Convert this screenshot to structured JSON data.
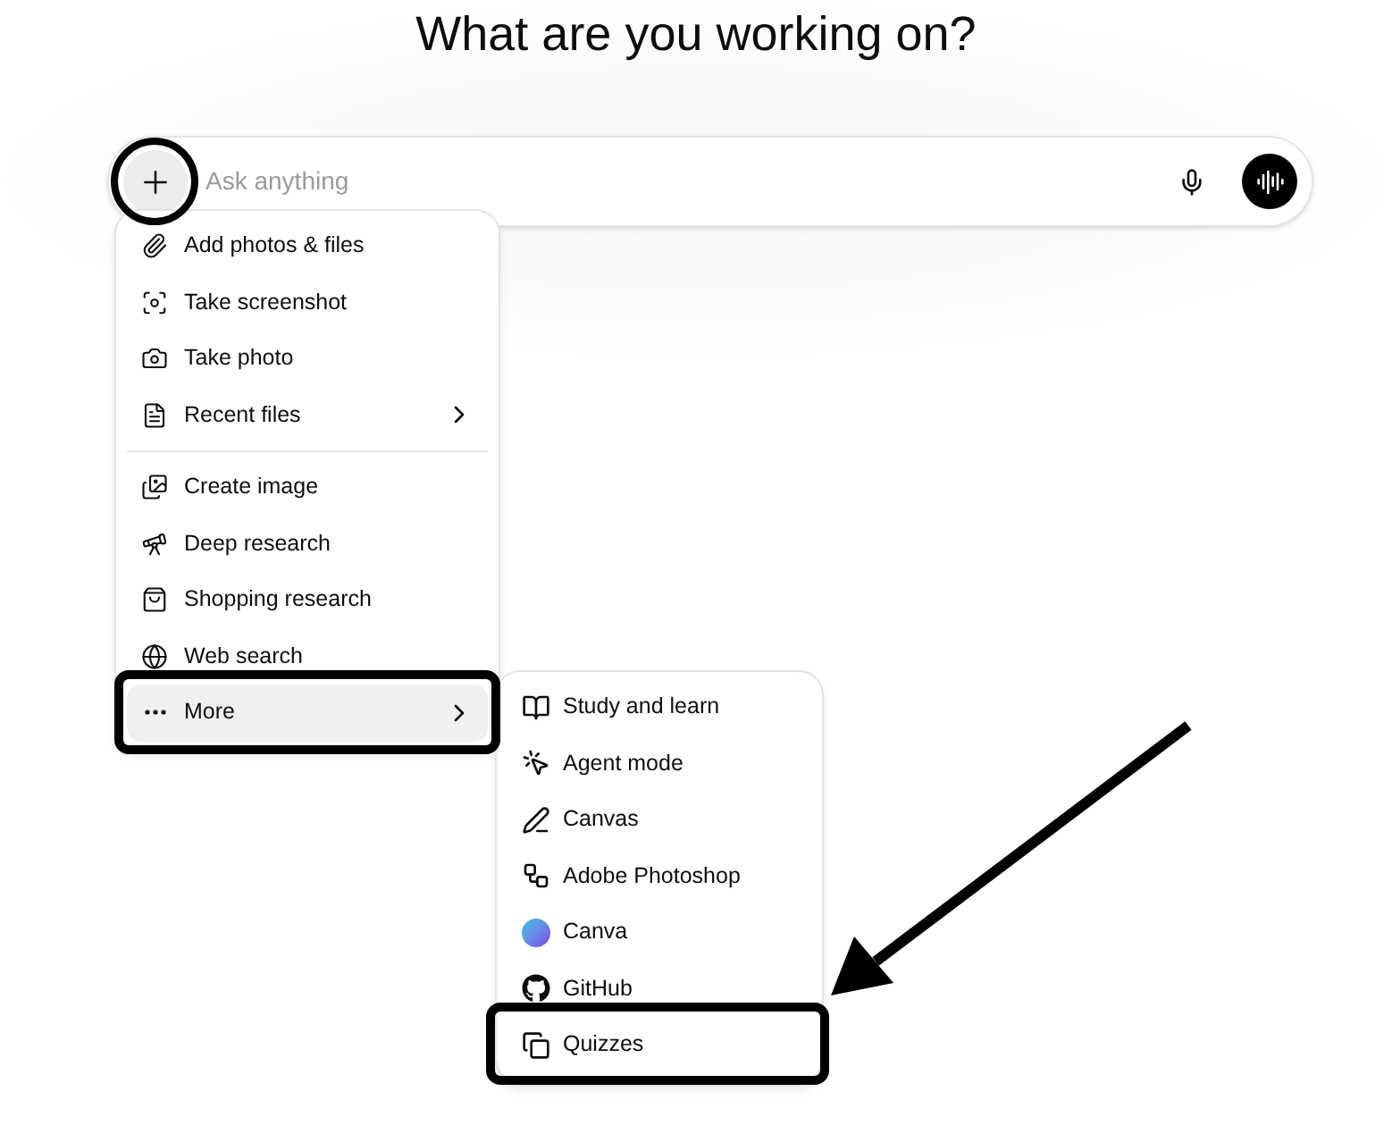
{
  "heading": "What are you working on?",
  "composer": {
    "placeholder": "Ask anything"
  },
  "menu": {
    "sections": [
      [
        {
          "label": "Add photos & files",
          "submenu": false,
          "highlighted": false
        },
        {
          "label": "Take screenshot",
          "submenu": false,
          "highlighted": false
        },
        {
          "label": "Take photo",
          "submenu": false,
          "highlighted": false
        },
        {
          "label": "Recent files",
          "submenu": true,
          "highlighted": false
        }
      ],
      [
        {
          "label": "Create image",
          "submenu": false,
          "highlighted": false
        },
        {
          "label": "Deep research",
          "submenu": false,
          "highlighted": false
        },
        {
          "label": "Shopping research",
          "submenu": false,
          "highlighted": false
        },
        {
          "label": "Web search",
          "submenu": false,
          "highlighted": false
        },
        {
          "label": "More",
          "submenu": true,
          "highlighted": true
        }
      ]
    ]
  },
  "submenu": {
    "items": [
      {
        "label": "Study and learn"
      },
      {
        "label": "Agent mode"
      },
      {
        "label": "Canvas"
      },
      {
        "label": "Adobe Photoshop"
      },
      {
        "label": "Canva"
      },
      {
        "label": "GitHub"
      },
      {
        "label": "Quizzes"
      }
    ]
  }
}
